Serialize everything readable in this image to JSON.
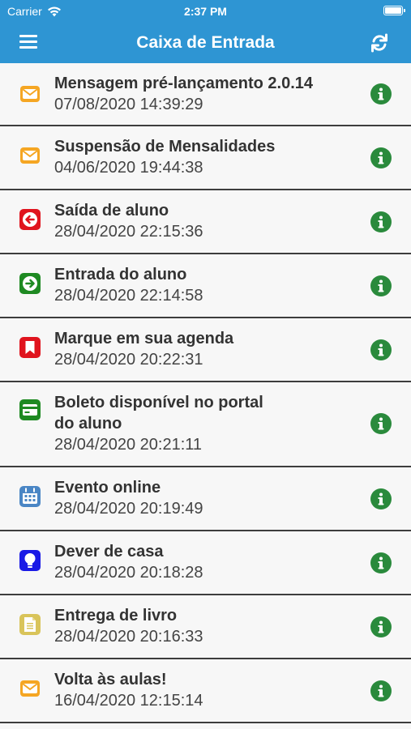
{
  "status": {
    "carrier": "Carrier",
    "time": "2:37 PM"
  },
  "header": {
    "title": "Caixa de Entrada"
  },
  "messages": [
    {
      "title": "Mensagem pré-lançamento 2.0.14",
      "date": "07/08/2020 14:39:29",
      "icon": "envelope-icon",
      "color": "#f5a623"
    },
    {
      "title": "Suspensão de Mensalidades",
      "date": "04/06/2020 19:44:38",
      "icon": "envelope-icon",
      "color": "#f5a623"
    },
    {
      "title": "Saída de aluno",
      "date": "28/04/2020 22:15:36",
      "icon": "exit-arrow-icon",
      "color": "#e0141e"
    },
    {
      "title": "Entrada do aluno",
      "date": "28/04/2020 22:14:58",
      "icon": "enter-arrow-icon",
      "color": "#1e8a22"
    },
    {
      "title": "Marque em sua agenda",
      "date": "28/04/2020 20:22:31",
      "icon": "bookmark-icon",
      "color": "#e0141e"
    },
    {
      "title_line1": "Boleto disponível no portal",
      "title_line2": "do aluno",
      "date": "28/04/2020 20:21:11",
      "icon": "credit-card-icon",
      "color": "#1e8a22"
    },
    {
      "title": "Evento online",
      "date": "28/04/2020 20:19:49",
      "icon": "calendar-icon",
      "color": "#4a86c5"
    },
    {
      "title": "Dever de casa",
      "date": "28/04/2020 20:18:28",
      "icon": "lightbulb-icon",
      "color": "#1a1ae6"
    },
    {
      "title": "Entrega de livro",
      "date": "28/04/2020 20:16:33",
      "icon": "document-icon",
      "color": "#d9c45a"
    },
    {
      "title": "Volta às aulas!",
      "date": "16/04/2020 12:15:14",
      "icon": "envelope-icon",
      "color": "#f5a623"
    }
  ]
}
